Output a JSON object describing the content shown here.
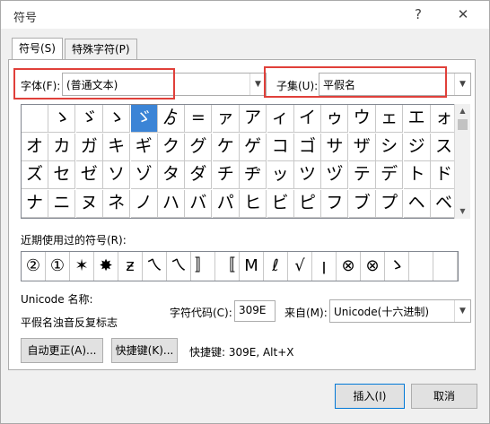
{
  "window": {
    "title": "符号",
    "help": "?",
    "close": "✕"
  },
  "tabs": [
    {
      "label": "符号(S)"
    },
    {
      "label": "特殊字符(P)"
    }
  ],
  "font": {
    "label": "字体(F):",
    "value": "(普通文本)"
  },
  "subset": {
    "label": "子集(U):",
    "value": "平假名"
  },
  "symbol_grid": [
    [
      "",
      "ゝ",
      "ゞ",
      "ゝ",
      "ゞ",
      "ゟ",
      "=",
      "ァ",
      "ア",
      "ィ",
      "イ",
      "ゥ",
      "ウ",
      "ェ",
      "エ",
      "ォ"
    ],
    [
      "オ",
      "カ",
      "ガ",
      "キ",
      "ギ",
      "ク",
      "グ",
      "ケ",
      "ゲ",
      "コ",
      "ゴ",
      "サ",
      "ザ",
      "シ",
      "ジ",
      "ス"
    ],
    [
      "ズ",
      "セ",
      "ゼ",
      "ソ",
      "ゾ",
      "タ",
      "ダ",
      "チ",
      "ヂ",
      "ッ",
      "ツ",
      "ヅ",
      "テ",
      "デ",
      "ト",
      "ド"
    ],
    [
      "ナ",
      "ニ",
      "ヌ",
      "ネ",
      "ノ",
      "ハ",
      "バ",
      "パ",
      "ヒ",
      "ビ",
      "ピ",
      "フ",
      "ブ",
      "プ",
      "ヘ",
      "ベ"
    ]
  ],
  "recent": {
    "label": "近期使用过的符号(R):",
    "symbols": [
      "②",
      "①",
      "✶",
      "✸",
      "ƶ",
      "ㄟ",
      "ㄟ",
      "〛",
      "〚",
      "M",
      "ℓ",
      "√",
      "ꞁ",
      "⊗",
      "⊗",
      "ゝ",
      "",
      ""
    ]
  },
  "unicode_name": {
    "label": "Unicode 名称:",
    "value": "平假名浊音反复标志"
  },
  "char_code": {
    "label": "字符代码(C):",
    "value": "309E"
  },
  "from": {
    "label": "来自(M):",
    "value": "Unicode(十六进制)"
  },
  "buttons": {
    "autocorrect": "自动更正(A)...",
    "shortcut": "快捷键(K)...",
    "insert": "插入(I)",
    "cancel": "取消"
  },
  "shortcut_text": "快捷键: 309E, Alt+X",
  "colors": {
    "highlight": "#3b84d6",
    "red_box": "#e0403a"
  }
}
